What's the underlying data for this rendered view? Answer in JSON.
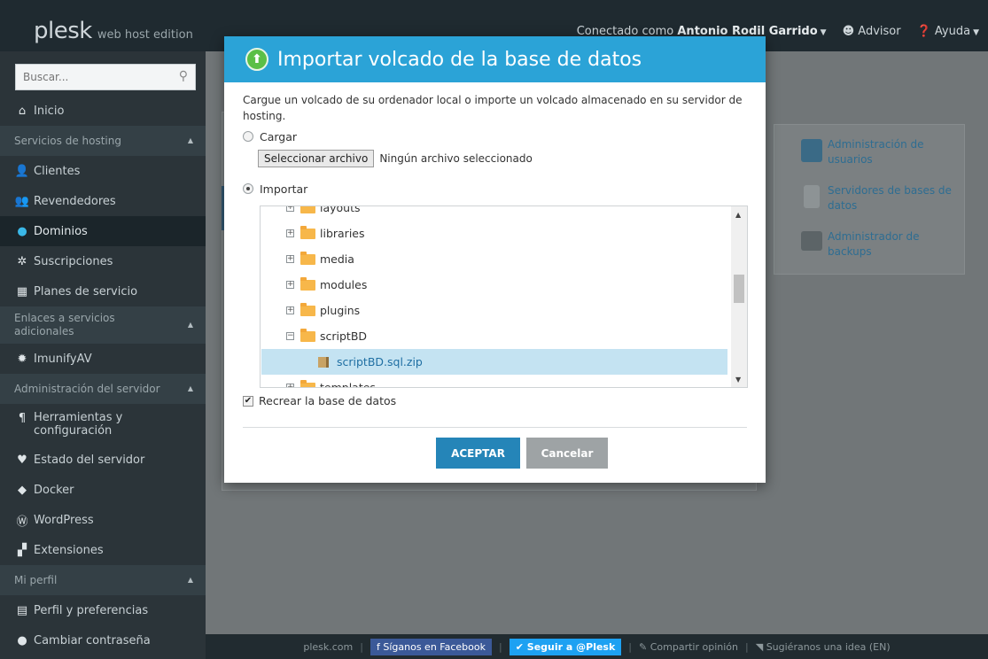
{
  "header": {
    "logo": "plesk",
    "edition": "web host edition",
    "connected_label": "Conectado como",
    "user_name": "Antonio Rodil Garrido",
    "advisor": "Advisor",
    "help": "Ayuda"
  },
  "sidebar": {
    "search_placeholder": "Buscar...",
    "home": "Inicio",
    "section_hosting": "Servicios de hosting",
    "clients": "Clientes",
    "resellers": "Revendedores",
    "domains": "Dominios",
    "subscriptions": "Suscripciones",
    "service_plans": "Planes de servicio",
    "section_links": "Enlaces a servicios adicionales",
    "imunify": "ImunifyAV",
    "section_admin": "Administración del servidor",
    "tools": "Herramientas y configuración",
    "server_status": "Estado del servidor",
    "docker": "Docker",
    "wordpress": "WordPress",
    "extensions": "Extensiones",
    "section_profile": "Mi perfil",
    "profile_prefs": "Perfil y preferencias",
    "change_password": "Cambiar contraseña"
  },
  "right_panel": {
    "users_admin": "Administración de usuarios",
    "db_servers": "Servidores de bases de datos",
    "backup_manager": "Administrador de backups"
  },
  "modal": {
    "title": "Importar volcado de la base de datos",
    "description": "Cargue un volcado de su ordenador local o importe un volcado almacenado en su servidor de hosting.",
    "option_upload": "Cargar",
    "file_button": "Seleccionar archivo",
    "file_status": "Ningún archivo seleccionado",
    "option_import": "Importar",
    "tree": [
      "layouts",
      "libraries",
      "media",
      "modules",
      "plugins",
      "scriptBD",
      "scriptBD.sql.zip",
      "templates"
    ],
    "recreate_label": "Recrear la base de datos",
    "ok_button": "ACEPTAR",
    "cancel_button": "Cancelar"
  },
  "footer": {
    "site": "plesk.com",
    "facebook": "Síganos en Facebook",
    "twitter": "Seguir a @Plesk",
    "share": "Compartir opinión",
    "suggest": "Sugiéranos una idea (EN)"
  }
}
